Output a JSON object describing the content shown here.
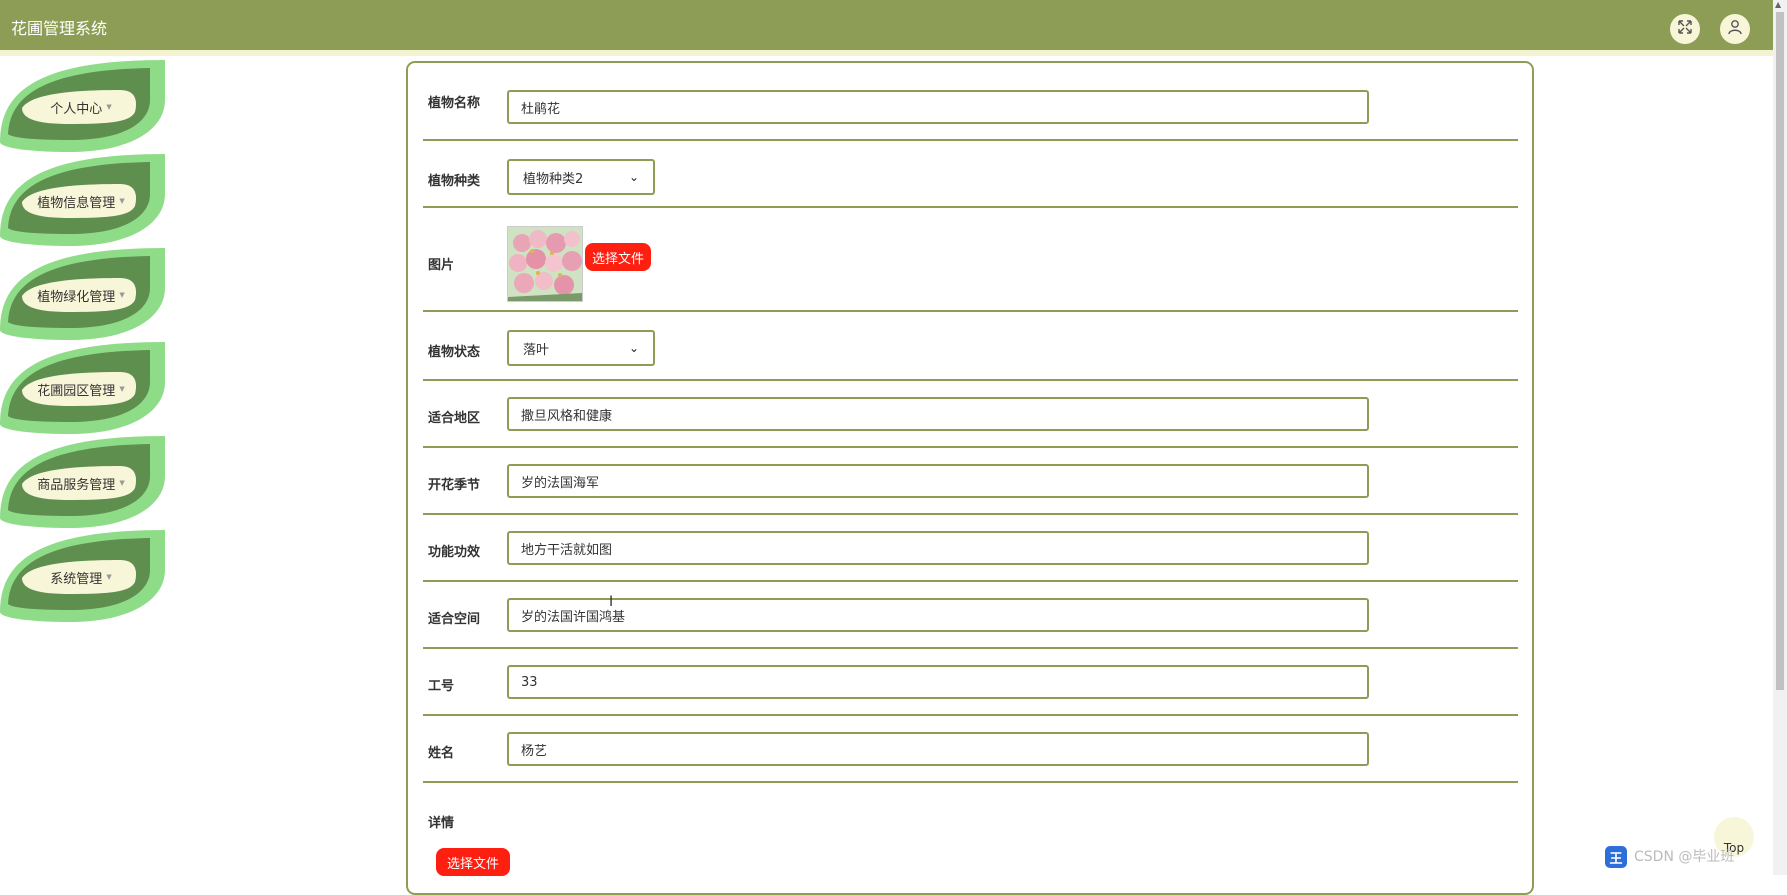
{
  "header": {
    "title": "花圃管理系统",
    "fullscreen_icon": "expand-icon",
    "user_icon": "user-icon"
  },
  "sidebar": {
    "items": [
      {
        "label": "个人中心"
      },
      {
        "label": "植物信息管理"
      },
      {
        "label": "植物绿化管理"
      },
      {
        "label": "花圃园区管理"
      },
      {
        "label": "商品服务管理"
      },
      {
        "label": "系统管理"
      }
    ]
  },
  "form": {
    "plant_name": {
      "label": "植物名称",
      "value": "杜鹃花"
    },
    "plant_type": {
      "label": "植物种类",
      "value": "植物种类2"
    },
    "image": {
      "label": "图片",
      "button": "选择文件"
    },
    "plant_status": {
      "label": "植物状态",
      "value": "落叶"
    },
    "region": {
      "label": "适合地区",
      "value": "撒旦风格和健康"
    },
    "bloom_season": {
      "label": "开花季节",
      "value": "岁的法国海军"
    },
    "function": {
      "label": "功能功效",
      "value": "地方干活就如图"
    },
    "space": {
      "label": "适合空间",
      "value": "岁的法国许国鸿基"
    },
    "staff_no": {
      "label": "工号",
      "value": "33"
    },
    "name": {
      "label": "姓名",
      "value": "杨艺"
    },
    "detail": {
      "label": "详情",
      "button": "选择文件"
    }
  },
  "back_to_top": "Top",
  "watermark": "CSDN @毕业班",
  "colors": {
    "primary": "#8e9d55",
    "cream": "#f8f6d9",
    "accent_red": "#ff1f10",
    "leaf_dark": "#5e8f4e",
    "leaf_light": "#8fdc88"
  }
}
